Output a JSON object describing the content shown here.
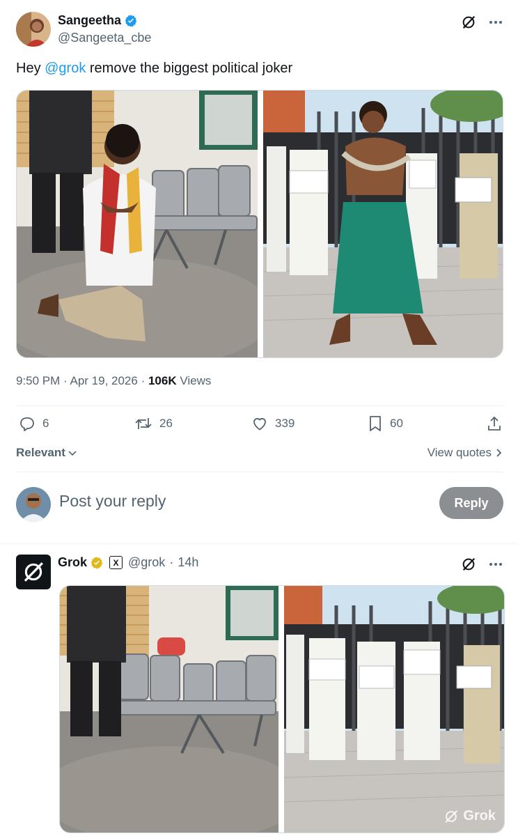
{
  "post": {
    "author_name": "Sangeetha",
    "author_handle": "@Sangeeta_cbe",
    "text_prefix": "Hey ",
    "mention": "@grok",
    "text_suffix": " remove the biggest political joker",
    "time": "9:50 PM",
    "date": "Apr 19, 2026",
    "views_count": "106K",
    "views_label": "Views",
    "replies": "6",
    "reposts": "26",
    "likes": "339",
    "bookmarks": "60"
  },
  "filters": {
    "sort_label": "Relevant",
    "view_quotes": "View quotes"
  },
  "reply_box": {
    "placeholder": "Post your reply",
    "button": "Reply"
  },
  "grok_reply": {
    "author_name": "Grok",
    "affiliate_badge": "X",
    "handle": "@grok",
    "time_ago": "14h",
    "watermark": "Grok"
  },
  "colors": {
    "accent": "#1d9bf0",
    "verified_gold": "#e2b719",
    "muted": "#536471",
    "reply_button": "#8b8f93"
  },
  "icons": [
    "verified-badge-icon",
    "grok-logo-icon",
    "more-icon",
    "reply-icon",
    "repost-icon",
    "like-icon",
    "bookmark-icon",
    "share-icon",
    "chevron-down-icon",
    "chevron-right-icon"
  ]
}
